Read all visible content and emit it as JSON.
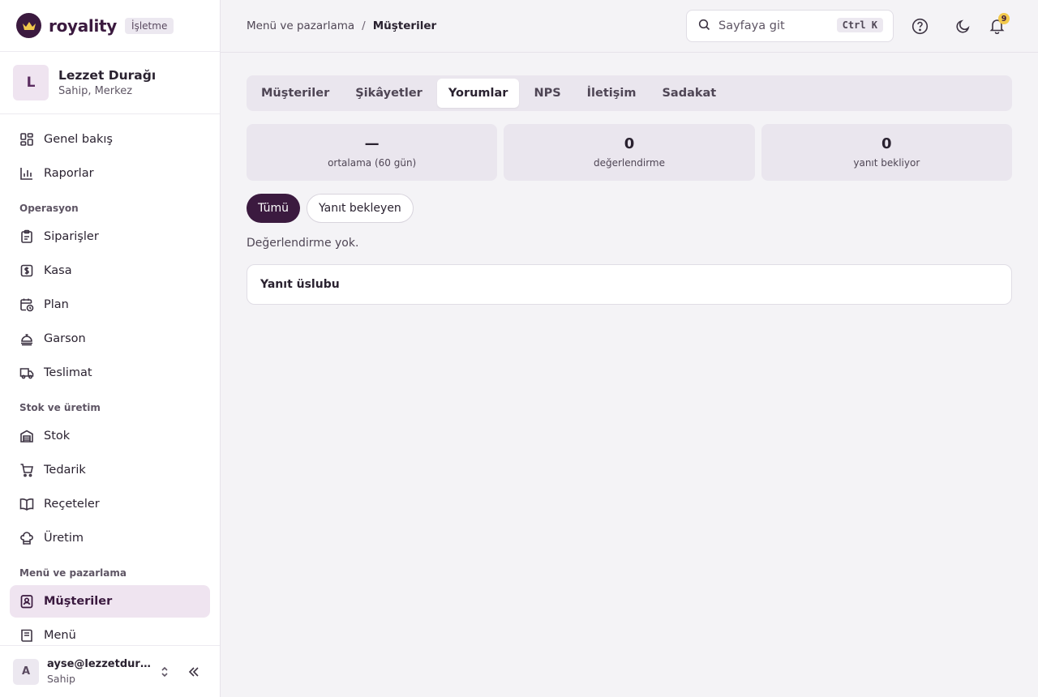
{
  "brand": {
    "name": "royality",
    "badge": "İşletme"
  },
  "org": {
    "initial": "L",
    "name": "Lezzet Durağı",
    "role": "Sahip, Merkez"
  },
  "nav": {
    "top": [
      {
        "label": "Genel bakış",
        "icon": "dashboard-grid-icon"
      },
      {
        "label": "Raporlar",
        "icon": "bar-chart-icon"
      }
    ],
    "sections": [
      {
        "title": "Operasyon",
        "items": [
          {
            "label": "Siparişler",
            "icon": "clipboard-icon"
          },
          {
            "label": "Kasa",
            "icon": "cash-register-icon"
          },
          {
            "label": "Plan",
            "icon": "calendar-clock-icon"
          },
          {
            "label": "Garson",
            "icon": "waiter-bell-icon"
          },
          {
            "label": "Teslimat",
            "icon": "delivery-truck-icon"
          }
        ]
      },
      {
        "title": "Stok ve üretim",
        "items": [
          {
            "label": "Stok",
            "icon": "warehouse-icon"
          },
          {
            "label": "Tedarik",
            "icon": "shopping-cart-icon"
          },
          {
            "label": "Reçeteler",
            "icon": "book-open-icon"
          },
          {
            "label": "Üretim",
            "icon": "chef-hat-icon"
          }
        ]
      },
      {
        "title": "Menü ve pazarlama",
        "items": [
          {
            "label": "Müşteriler",
            "icon": "contact-card-icon",
            "active": true
          },
          {
            "label": "Menü",
            "icon": "menu-book-icon"
          }
        ]
      }
    ]
  },
  "user": {
    "initial": "A",
    "email": "ayse@lezzetduragi.com",
    "role": "Sahip"
  },
  "topbar": {
    "breadcrumb": {
      "parent": "Menü ve pazarlama",
      "separator": "/",
      "current": "Müşteriler"
    },
    "search": {
      "placeholder": "Sayfaya git",
      "shortcut": "Ctrl K"
    },
    "notifications_count": "9"
  },
  "tabs": [
    {
      "label": "Müşteriler"
    },
    {
      "label": "Şikâyetler"
    },
    {
      "label": "Yorumlar",
      "active": true
    },
    {
      "label": "NPS"
    },
    {
      "label": "İletişim"
    },
    {
      "label": "Sadakat"
    }
  ],
  "stats": [
    {
      "value": "—",
      "label": "ortalama (60 gün)"
    },
    {
      "value": "0",
      "label": "değerlendirme"
    },
    {
      "value": "0",
      "label": "yanıt bekliyor"
    }
  ],
  "filters": [
    {
      "label": "Tümü",
      "active": true
    },
    {
      "label": "Yanıt bekleyen"
    }
  ],
  "empty_text": "Değerlendirme yok.",
  "reply_style": {
    "title": "Yanıt üslubu"
  },
  "colors": {
    "accent": "#3b1a3f",
    "accent_soft": "#efe4f0",
    "badge": "#f2c94c"
  }
}
